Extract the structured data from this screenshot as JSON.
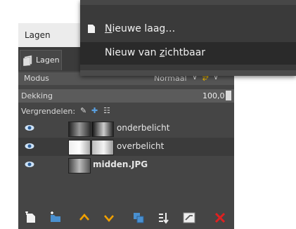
{
  "panel": {
    "title": "Lagen",
    "tab_label": "Lagen",
    "mode_label": "Modus",
    "mode_value": "Normaal",
    "opacity_label": "Dekking",
    "opacity_value": "100,0",
    "lock_label": "Vergrendelen:"
  },
  "layers": [
    {
      "name": "onderbelicht",
      "visible": true,
      "bold": false
    },
    {
      "name": "overbelicht",
      "visible": true,
      "bold": false
    },
    {
      "name": "midden.JPG",
      "visible": true,
      "bold": true
    }
  ],
  "menu": {
    "items": [
      {
        "label_pre": "",
        "label_u": "N",
        "label_post": "ieuwe laag…",
        "icon": "new-layer-icon"
      },
      {
        "label_pre": "Nieuw van ",
        "label_u": "z",
        "label_post": "ichtbaar",
        "icon": ""
      }
    ]
  },
  "toolbar_icons": [
    "new-layer-icon",
    "new-layer-group-icon",
    "raise-layer-icon",
    "lower-layer-icon",
    "duplicate-layer-icon",
    "anchor-layer-icon",
    "merge-layer-icon",
    "delete-layer-icon"
  ],
  "colors": {
    "accent_orange": "#f0a000",
    "delete_red": "#e02020",
    "eye_blue": "#5aa0e0"
  }
}
